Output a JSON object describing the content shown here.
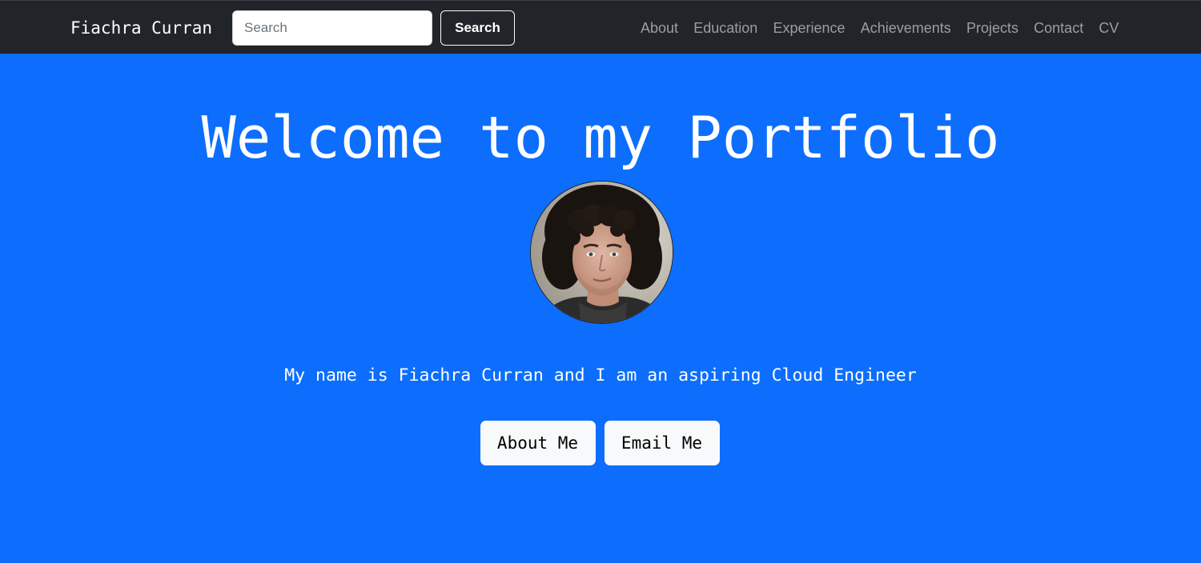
{
  "navbar": {
    "brand": "Fiachra Curran",
    "search": {
      "placeholder": "Search",
      "value": "",
      "button_label": "Search"
    },
    "links": [
      "About",
      "Education",
      "Experience",
      "Achievements",
      "Projects",
      "Contact",
      "CV"
    ]
  },
  "hero": {
    "title": "Welcome to my Portfolio",
    "avatar_icon": "profile-photo",
    "tagline": "My name is Fiachra Curran and I am an aspiring Cloud Engineer",
    "buttons": {
      "about_label": "About Me",
      "email_label": "Email Me"
    }
  },
  "colors": {
    "navbar_bg": "#212529",
    "hero_bg": "#0d6efd",
    "nav_link": "rgba(255,255,255,0.55)",
    "button_bg": "#f8f9fa"
  }
}
